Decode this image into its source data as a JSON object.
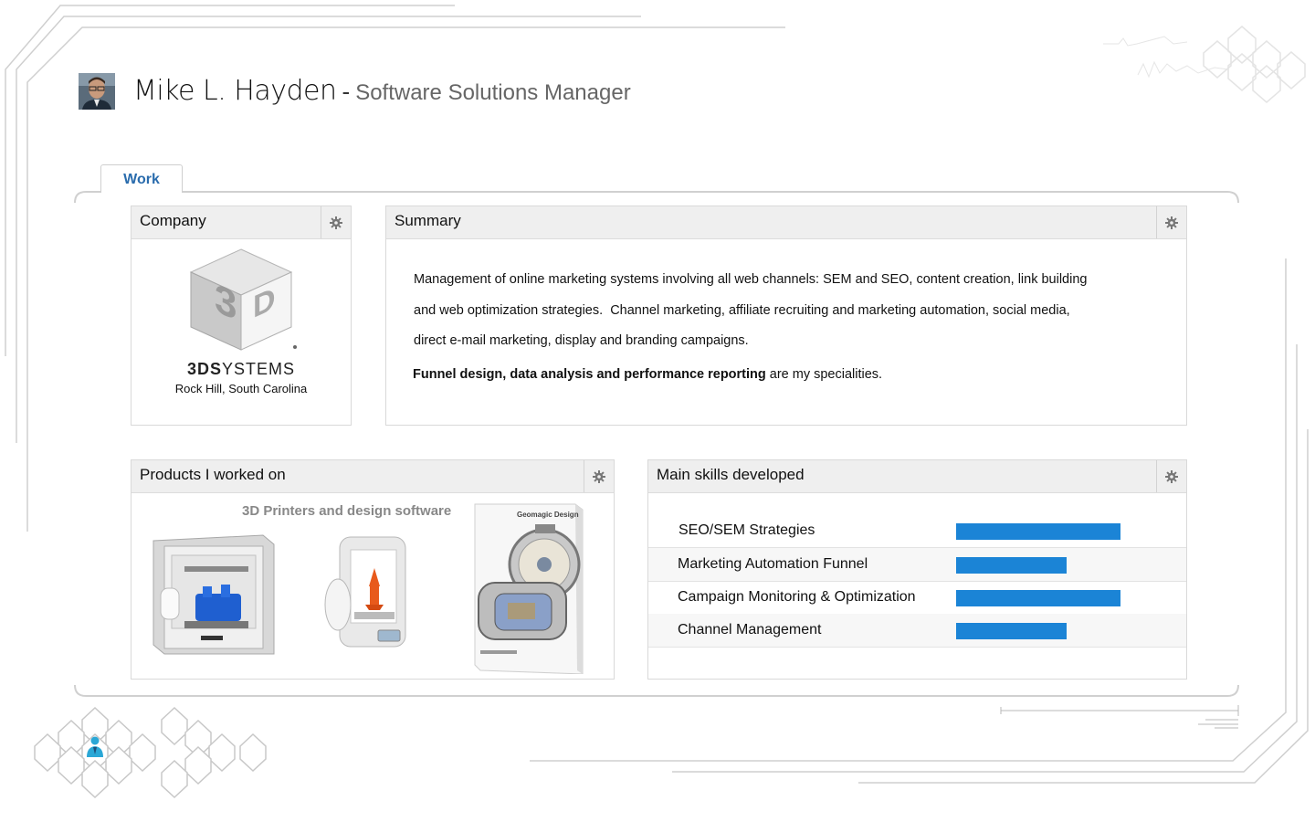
{
  "header": {
    "name": "Mike L. Hayden",
    "separator": "-",
    "role": "Software Solutions Manager"
  },
  "tabs": [
    {
      "label": "Work",
      "active": true
    }
  ],
  "company": {
    "title": "Company",
    "logo_text_bold": "3DS",
    "logo_text_light": "YSTEMS",
    "location": "Rock Hill, South Carolina"
  },
  "summary": {
    "title": "Summary",
    "lines": [
      "Management of online marketing systems involving all web channels: SEM and SEO, content creation, link building",
      "and web optimization strategies.  Channel marketing, affiliate recruiting and marketing automation, social media,",
      "direct e-mail marketing, display and branding campaigns."
    ],
    "specialties_bold": "Funnel design, data analysis and performance reporting",
    "specialties_rest": " are my specialities."
  },
  "products": {
    "title": "Products I worked on",
    "caption": "3D Printers and design software",
    "box_label": "Geomagic Design"
  },
  "skills": {
    "title": "Main skills developed",
    "items": [
      {
        "label": "SEO/SEM Strategies",
        "level": 1.0
      },
      {
        "label": "Marketing Automation Funnel",
        "level": 0.67
      },
      {
        "label": "Campaign Monitoring & Optimization",
        "level": 1.0
      },
      {
        "label": "Channel Management",
        "level": 0.67
      }
    ]
  },
  "icons": {
    "gear": "gear-icon",
    "user": "person-icon"
  },
  "colors": {
    "accent": "#2a6cad",
    "skill_bar": "#1b84d6",
    "panel_header": "#efefef",
    "frame": "#cfcfcf",
    "hex_outline": "#c8c8c8",
    "person_icon": "#2aa7d6"
  }
}
